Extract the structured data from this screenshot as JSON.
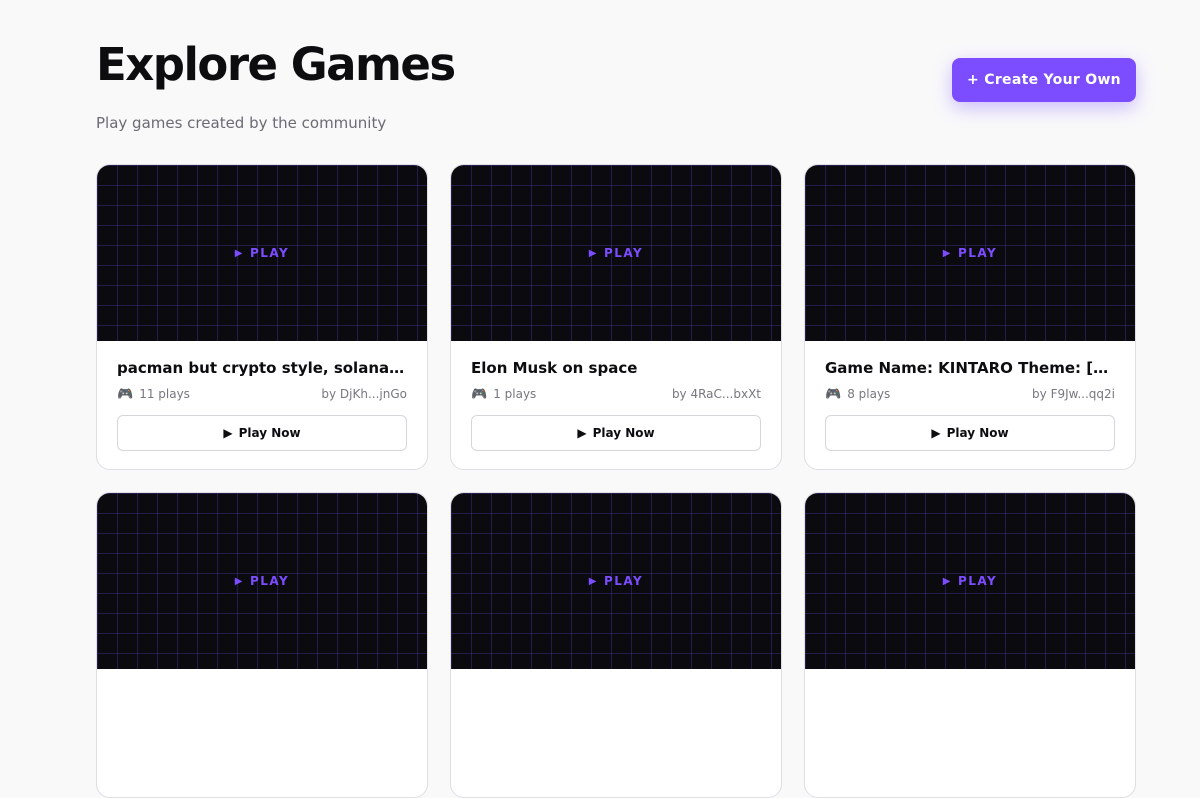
{
  "header": {
    "title": "Explore Games",
    "subtitle": "Play games created by the community",
    "create_label": "+ Create Your Own"
  },
  "play_overlay_label": "PLAY",
  "play_now_label": "Play Now",
  "games": [
    {
      "title": "pacman but crypto style, solana as ...",
      "plays": "11 plays",
      "author": "by DjKh...jnGo"
    },
    {
      "title": "Elon Musk on space",
      "plays": "1 plays",
      "author": "by 4RaC...bxXt"
    },
    {
      "title": "Game Name: KINTARO Theme: [Fanta...",
      "plays": "8 plays",
      "author": "by F9Jw...qq2i"
    },
    {
      "title": "",
      "plays": "",
      "author": ""
    },
    {
      "title": "",
      "plays": "",
      "author": ""
    },
    {
      "title": "",
      "plays": "",
      "author": ""
    }
  ],
  "colors": {
    "accent": "#7c4dff",
    "thumb_bg": "#0a0a0f",
    "page_bg": "#f9f9fa"
  }
}
